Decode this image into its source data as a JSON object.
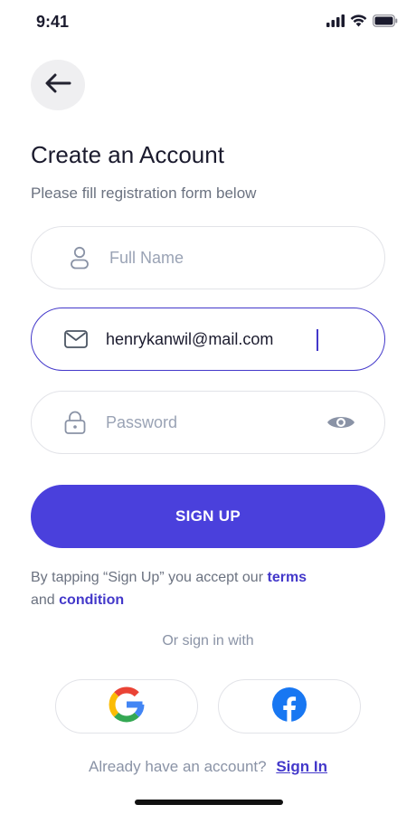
{
  "status_bar": {
    "time": "9:41"
  },
  "header": {
    "back_icon": "arrow-left-icon",
    "title": "Create an Account",
    "subtitle": "Please fill registration form below"
  },
  "form": {
    "full_name": {
      "icon": "user-icon",
      "value": "",
      "placeholder": "Full Name"
    },
    "email": {
      "icon": "mail-icon",
      "value": "henrykanwil@mail.com",
      "placeholder": ""
    },
    "password": {
      "icon": "lock-icon",
      "value": "",
      "placeholder": "Password",
      "toggle_icon": "eye-icon"
    }
  },
  "signup": {
    "label": "SIGN UP"
  },
  "terms": {
    "prefix": "By tapping “Sign Up” you accept our",
    "terms_link": "terms",
    "and_text": "and",
    "condition_link": "condition"
  },
  "social": {
    "divider_text": "Or sign in with",
    "google_icon": "google-icon",
    "facebook_icon": "facebook-icon"
  },
  "footer": {
    "prompt": "Already have an account?",
    "signin_link": "Sign In"
  },
  "colors": {
    "accent": "#4a40dc",
    "accent_text": "#4338ca",
    "muted_text": "#6b7280",
    "placeholder": "#9aa3b5",
    "border": "#e2e3e8"
  }
}
